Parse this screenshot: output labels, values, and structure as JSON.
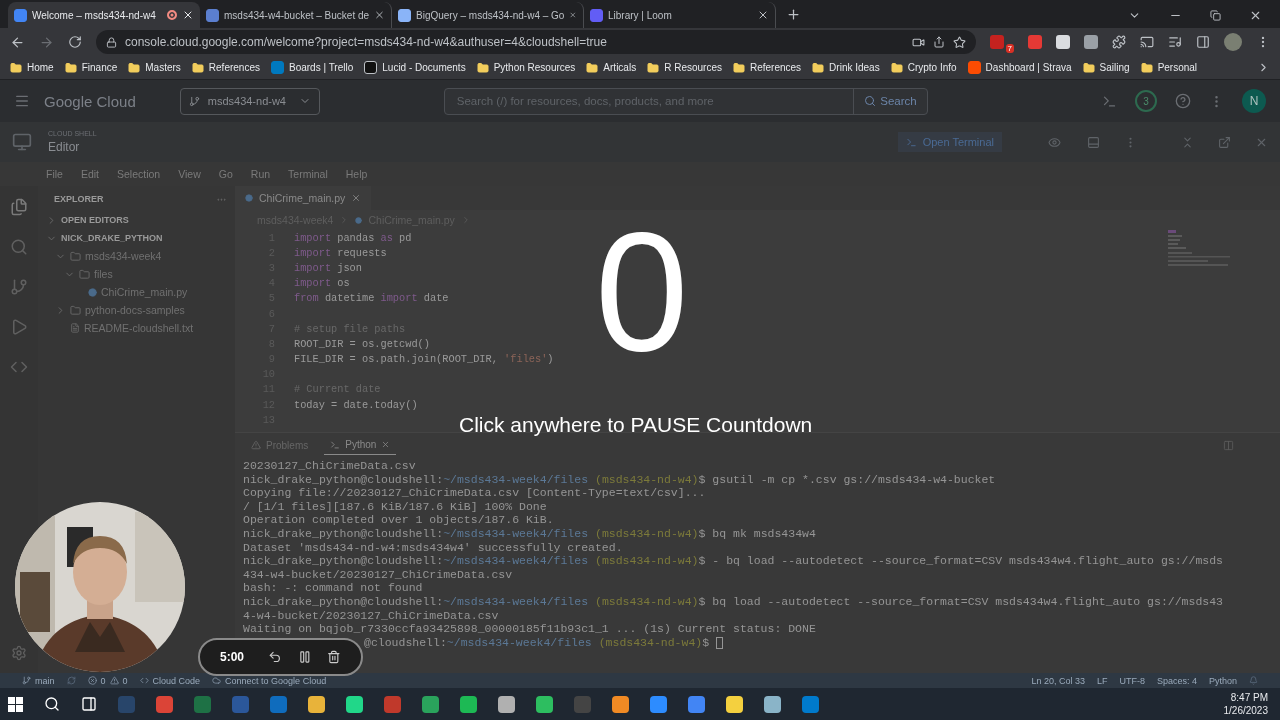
{
  "browser": {
    "tabs": [
      {
        "label": "Welcome – msds434-nd-w4",
        "kind": "cloud",
        "selected": true,
        "recording": true
      },
      {
        "label": "msds434-w4-bucket – Bucket de",
        "kind": "storage",
        "selected": false,
        "recording": false
      },
      {
        "label": "BigQuery – msds434-nd-w4 – Go",
        "kind": "bigquery",
        "selected": false,
        "recording": false
      },
      {
        "label": "Library | Loom",
        "kind": "loom",
        "selected": false,
        "recording": false
      }
    ],
    "url": "console.cloud.google.com/welcome?project=msds434-nd-w4&authuser=4&cloudshell=true",
    "extension_badge": "7",
    "bookmarks": [
      {
        "label": "Home",
        "kind": "folder"
      },
      {
        "label": "Finance",
        "kind": "folder"
      },
      {
        "label": "Masters",
        "kind": "folder"
      },
      {
        "label": "References",
        "kind": "folder"
      },
      {
        "label": "Boards | Trello",
        "kind": "trello"
      },
      {
        "label": "Lucid - Documents",
        "kind": "lucid"
      },
      {
        "label": "Python Resources",
        "kind": "folder"
      },
      {
        "label": "Articals",
        "kind": "folder"
      },
      {
        "label": "R Resources",
        "kind": "folder"
      },
      {
        "label": "References",
        "kind": "folder"
      },
      {
        "label": "Drink Ideas",
        "kind": "folder"
      },
      {
        "label": "Crypto Info",
        "kind": "folder"
      },
      {
        "label": "Dashboard | Strava",
        "kind": "strava"
      },
      {
        "label": "Sailing",
        "kind": "folder"
      },
      {
        "label": "Personal",
        "kind": "folder"
      }
    ]
  },
  "console": {
    "logo": "Google Cloud",
    "project": "msds434-nd-w4",
    "search": {
      "placeholder": "Search (/) for resources, docs, products, and more",
      "button": "Search"
    },
    "notifications": "3",
    "avatar": "N"
  },
  "cloud_shell": {
    "label": "CLOUD SHELL",
    "title": "Editor",
    "open_terminal": "Open Terminal"
  },
  "menu": [
    "File",
    "Edit",
    "Selection",
    "View",
    "Go",
    "Run",
    "Terminal",
    "Help"
  ],
  "explorer": {
    "title": "EXPLORER",
    "sections": [
      {
        "label": "OPEN EDITORS",
        "expanded": false
      },
      {
        "label": "NICK_DRAKE_PYTHON",
        "expanded": true,
        "children": [
          {
            "label": "msds434-week4",
            "kind": "folder",
            "expanded": true,
            "children": [
              {
                "label": "files",
                "kind": "folder",
                "expanded": true,
                "children": [
                  {
                    "label": "ChiCrime_main.py",
                    "kind": "python"
                  }
                ]
              }
            ]
          },
          {
            "label": "python-docs-samples",
            "kind": "folder",
            "expanded": false
          },
          {
            "label": "README-cloudshell.txt",
            "kind": "text"
          }
        ]
      }
    ]
  },
  "editor": {
    "tabs": [
      {
        "label": "ChiCrime_main.py",
        "selected": true
      }
    ],
    "breadcrumb": [
      "msds434-week4",
      "ChiCrime_main.py"
    ],
    "lines": [
      {
        "number": "1",
        "tokens": [
          {
            "kind": "keyword",
            "text": "import"
          },
          {
            "kind": "plain",
            "text": " pandas "
          },
          {
            "kind": "keyword",
            "text": "as"
          },
          {
            "kind": "plain",
            "text": " pd"
          }
        ]
      },
      {
        "number": "2",
        "tokens": [
          {
            "kind": "keyword",
            "text": "import"
          },
          {
            "kind": "plain",
            "text": " requests"
          }
        ]
      },
      {
        "number": "3",
        "tokens": [
          {
            "kind": "keyword",
            "text": "import"
          },
          {
            "kind": "plain",
            "text": " json"
          }
        ]
      },
      {
        "number": "4",
        "tokens": [
          {
            "kind": "keyword",
            "text": "import"
          },
          {
            "kind": "plain",
            "text": " os"
          }
        ]
      },
      {
        "number": "5",
        "tokens": [
          {
            "kind": "keyword",
            "text": "from"
          },
          {
            "kind": "plain",
            "text": " datetime "
          },
          {
            "kind": "keyword",
            "text": "import"
          },
          {
            "kind": "plain",
            "text": " date"
          }
        ]
      },
      {
        "number": "6"
      },
      {
        "number": "7",
        "tokens": [
          {
            "kind": "comment",
            "text": "# setup file paths"
          }
        ]
      },
      {
        "number": "8",
        "tokens": [
          {
            "kind": "plain",
            "text": "ROOT_DIR = os.getcwd()"
          }
        ]
      },
      {
        "number": "9",
        "tokens": [
          {
            "kind": "plain",
            "text": "FILE_DIR = os.path.join(ROOT_DIR, "
          },
          {
            "kind": "string",
            "text": "'files'"
          },
          {
            "kind": "plain",
            "text": ")"
          }
        ]
      },
      {
        "number": "10"
      },
      {
        "number": "11",
        "tokens": [
          {
            "kind": "comment",
            "text": "# Current date"
          }
        ]
      },
      {
        "number": "12",
        "tokens": [
          {
            "kind": "plain",
            "text": "today = date.today()"
          }
        ]
      },
      {
        "number": "13"
      }
    ]
  },
  "panel": {
    "tabs": [
      {
        "label": "Problems",
        "kind": "problems",
        "selected": false
      },
      {
        "label": "Python",
        "kind": "terminal",
        "selected": true
      }
    ],
    "terminal": [
      {
        "kind": "output",
        "text": "20230127_ChiCrimeData.csv"
      },
      {
        "kind": "prompt",
        "user": "nick_drake_python@cloudshell:",
        "path": "~/msds434-week4/files",
        "project": "(msds434-nd-w4)",
        "symbol": "$",
        "command": "gsutil -m cp *.csv gs://msds434-w4-bucket"
      },
      {
        "kind": "output",
        "text": "Copying file://20230127_ChiCrimeData.csv [Content-Type=text/csv]..."
      },
      {
        "kind": "output",
        "text": "/ [1/1 files][187.6 KiB/187.6 KiB] 100% Done"
      },
      {
        "kind": "output",
        "text": "Operation completed over 1 objects/187.6 KiB."
      },
      {
        "kind": "prompt",
        "user": "nick_drake_python@cloudshell:",
        "path": "~/msds434-week4/files",
        "project": "(msds434-nd-w4)",
        "symbol": "$",
        "command": "bq mk msds434w4"
      },
      {
        "kind": "output",
        "text": "Dataset 'msds434-nd-w4:msds434w4' successfully created."
      },
      {
        "kind": "prompt",
        "user": "nick_drake_python@cloudshell:",
        "path": "~/msds434-week4/files",
        "project": "(msds434-nd-w4)",
        "symbol": "$",
        "command": "- bq load --autodetect --source_format=CSV msds434w4.flight_auto gs://msds"
      },
      {
        "kind": "output",
        "text": "434-w4-bucket/20230127_ChiCrimeData.csv"
      },
      {
        "kind": "output",
        "text": "bash: -: command not found"
      },
      {
        "kind": "prompt",
        "user": "nick_drake_python@cloudshell:",
        "path": "~/msds434-week4/files",
        "project": "(msds434-nd-w4)",
        "symbol": "$",
        "command": "bq load --autodetect --source_format=CSV msds434w4.flight_auto gs://msds43"
      },
      {
        "kind": "output",
        "text": "4-w4-bucket/20230127_ChiCrimeData.csv"
      },
      {
        "kind": "output",
        "text": "Waiting on bqjob_r7330ccfa93425898_00000185f11b93c1_1 ... (1s) Current status: DONE"
      },
      {
        "kind": "prompt_tail",
        "user": "@cloudshell:",
        "path": "~/msds434-week4/files",
        "project": "(msds434-nd-w4)",
        "symbol": "$"
      }
    ]
  },
  "status_bar": {
    "branch": "main",
    "errors": "0",
    "warnings": "0",
    "left": [
      "Cloud Code",
      "Connect to Google Cloud"
    ],
    "right": [
      "Ln 20, Col 33",
      "LF",
      "UTF-8",
      "Spaces: 4",
      "Python"
    ]
  },
  "countdown": {
    "number": "0",
    "message": "Click anywhere to PAUSE Countdown"
  },
  "recorder": {
    "time": "5:00"
  },
  "taskbar": {
    "time": "8:47 PM",
    "date": "1/26/2023"
  }
}
